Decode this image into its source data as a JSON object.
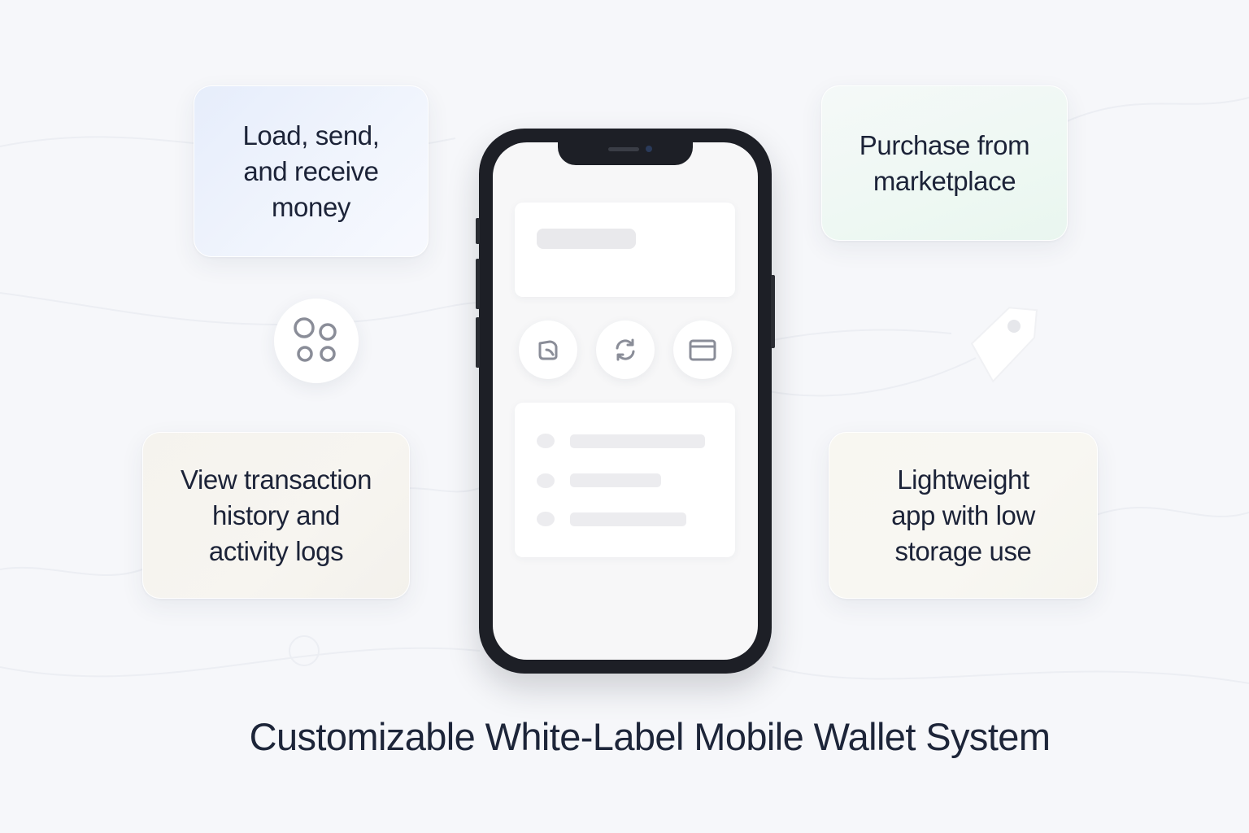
{
  "features": {
    "top_left": "Load, send,\nand receive\nmoney",
    "top_right": "Purchase from\nmarketplace",
    "bottom_left": "View transaction\nhistory and\nactivity logs",
    "bottom_right": "Lightweight\napp with low\nstorage use"
  },
  "title": "Customizable White-Label Mobile Wallet System",
  "icons": {
    "apps": "apps-icon",
    "tag": "price-tag-icon",
    "wallet": "wallet-icon",
    "refresh": "refresh-icon",
    "card": "credit-card-icon"
  },
  "colors": {
    "background": "#f6f7fa",
    "text": "#1c2338",
    "phone_frame": "#1d1f26",
    "icon_stroke": "#8a8d98"
  }
}
